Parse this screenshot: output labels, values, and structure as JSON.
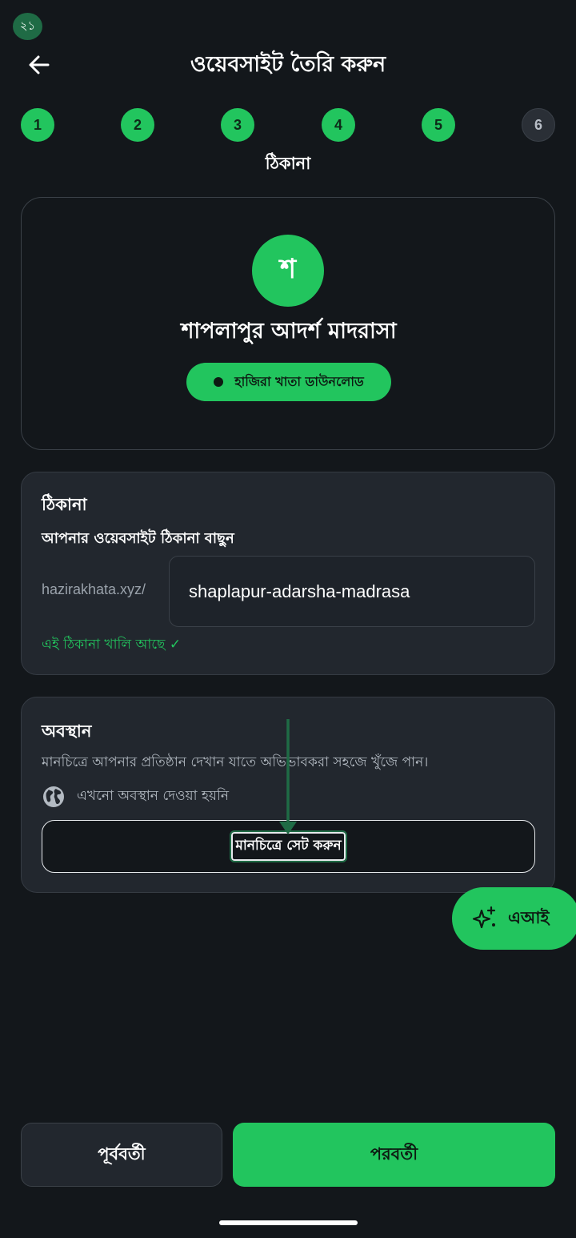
{
  "status_bar": {
    "badge": "২১"
  },
  "header": {
    "title": "ওয়েবসাইট তৈরি করুন"
  },
  "stepper": {
    "steps": [
      {
        "label": "1",
        "state": "completed"
      },
      {
        "label": "2",
        "state": "completed"
      },
      {
        "label": "3",
        "state": "completed"
      },
      {
        "label": "4",
        "state": "completed"
      },
      {
        "label": "5",
        "state": "completed"
      },
      {
        "label": "6",
        "state": "pending"
      }
    ],
    "current_label": "ঠিকানা"
  },
  "preview": {
    "avatar_letter": "শ",
    "org_name": "শাপলাপুর আদর্শ মাদরাসা",
    "app_pill_label": "হাজিরা খাতা ডাউনলোড"
  },
  "address_card": {
    "title": "ঠিকানা",
    "subtitle": "আপনার ওয়েবসাইট ঠিকানা বাছুন",
    "domain_prefix": "hazirakhata.xyz/",
    "slug_value": "shaplapur-adarsha-madrasa",
    "available_text": "এই ঠিকানা খালি আছে ✓"
  },
  "location_card": {
    "title": "অবস্থান",
    "description": "মানচিত্রে আপনার প্রতিষ্ঠান দেখান যাতে অভিভাবকরা সহজে খুঁজে পান।",
    "status_icon": "globe-icon",
    "status_text": "এখনো অবস্থান দেওয়া হয়নি",
    "set_map_button": "মানচিত্রে সেট করুন"
  },
  "ai_fab": {
    "icon": "sparkles-icon",
    "label": "এআই"
  },
  "footer": {
    "prev_label": "পূর্ববর্তী",
    "next_label": "পরবর্তী"
  },
  "colors": {
    "accent": "#22c55e",
    "background": "#13171b",
    "card": "#22272e",
    "annotation_arrow": "#1f6b45"
  }
}
